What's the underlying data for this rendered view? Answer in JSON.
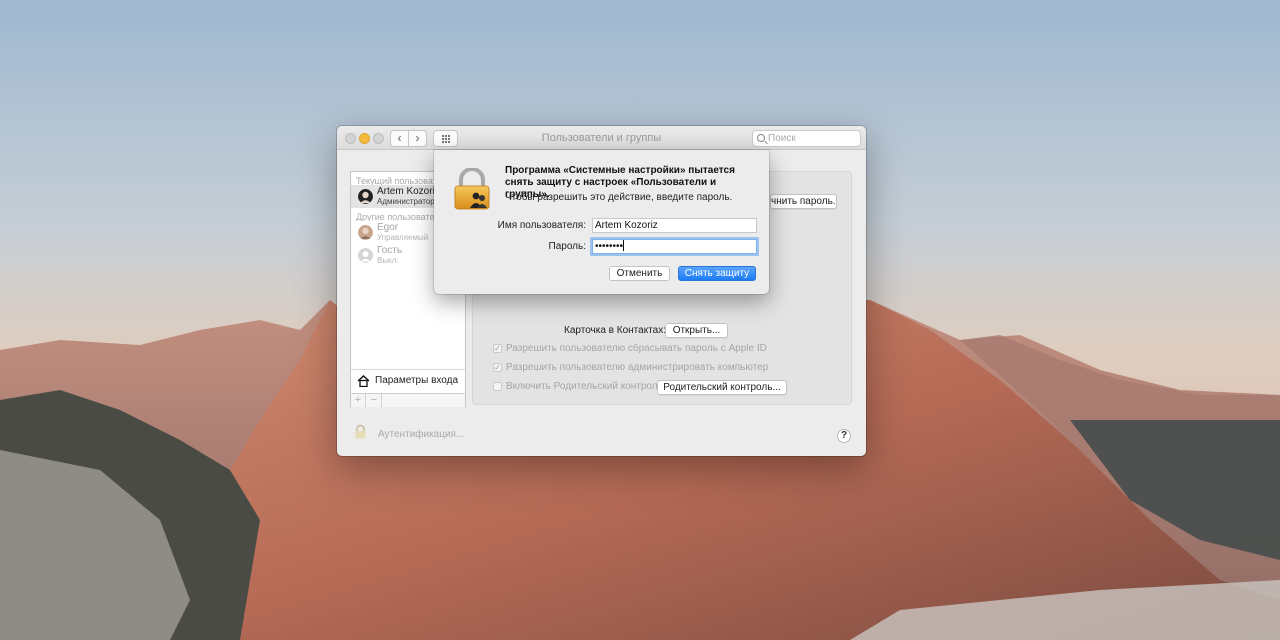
{
  "window": {
    "title": "Пользователи и группы",
    "search_placeholder": "Поиск",
    "nav_back": "‹",
    "nav_forward": "›"
  },
  "sidebar": {
    "current_section": "Текущий пользователь",
    "other_section": "Другие пользователи",
    "current_user": {
      "name": "Artem Kozoriz",
      "role": "Администратор"
    },
    "other_users": [
      {
        "name": "Egor",
        "role": "Управляемый"
      },
      {
        "name": "Гость",
        "role": "Выкл."
      }
    ],
    "login_options": "Параметры входа",
    "add": "+",
    "remove": "−"
  },
  "panel": {
    "change_password_button": "чнить пароль...",
    "contacts_card_label": "Карточка в Контактах:",
    "open_button": "Открыть...",
    "checkboxes": [
      {
        "label": "Разрешить пользователю сбрасывать пароль с Apple ID",
        "checked": true
      },
      {
        "label": "Разрешить пользователю администрировать компьютер",
        "checked": true
      },
      {
        "label": "Включить Родительский контроль",
        "checked": false
      }
    ],
    "parental_controls_button": "Родительский контроль..."
  },
  "footer": {
    "auth_text": "Аутентификация...",
    "help": "?"
  },
  "dialog": {
    "title": "Программа «Системные настройки» пытается снять защиту с настроек «Пользователи и группы».",
    "subtitle": "Чтобы разрешить это действие, введите пароль.",
    "username_label": "Имя пользователя:",
    "username_value": "Artem Kozoriz",
    "password_label": "Пароль:",
    "password_value": "••••••••",
    "cancel_button": "Отменить",
    "unlock_button": "Снять защиту"
  },
  "colors": {
    "accent": "#1d7bf4",
    "minimize_light": "#f4bc3c"
  }
}
